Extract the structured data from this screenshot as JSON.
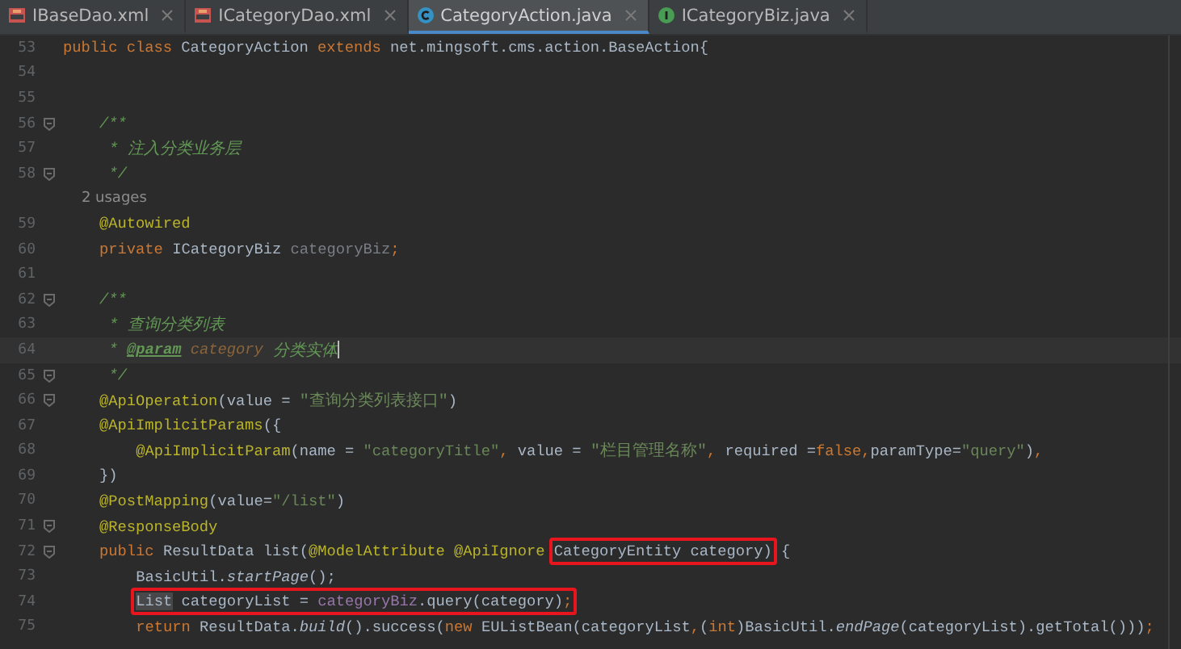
{
  "tabs": [
    {
      "label": "IBaseDao.xml",
      "kind": "xml",
      "selected": false
    },
    {
      "label": "ICategoryDao.xml",
      "kind": "xml",
      "selected": false
    },
    {
      "label": "CategoryAction.java",
      "kind": "class",
      "selected": true
    },
    {
      "label": "ICategoryBiz.java",
      "kind": "interface",
      "selected": false
    }
  ],
  "lines": [
    {
      "kind": "code",
      "number": "53",
      "fold": false,
      "current": false,
      "segments": [
        {
          "kind": "keyword",
          "text": "public class "
        },
        {
          "kind": "plain",
          "text": "CategoryAction "
        },
        {
          "kind": "keyword",
          "text": "extends "
        },
        {
          "kind": "plain",
          "text": "net.mingsoft.cms.action.BaseAction{"
        }
      ]
    },
    {
      "kind": "code",
      "number": "54",
      "fold": false,
      "current": false
    },
    {
      "kind": "code",
      "number": "55",
      "fold": false,
      "current": false
    },
    {
      "kind": "code",
      "number": "56",
      "fold": true,
      "current": false,
      "segments": [
        {
          "kind": "doc",
          "text": "    /**"
        }
      ]
    },
    {
      "kind": "code",
      "number": "57",
      "fold": false,
      "current": false,
      "segments": [
        {
          "kind": "doc",
          "text": "     * 注入分类业务层"
        }
      ]
    },
    {
      "kind": "code",
      "number": "58",
      "fold": true,
      "current": false,
      "segments": [
        {
          "kind": "doc",
          "text": "     */"
        }
      ]
    },
    {
      "kind": "hint",
      "text": "2 usages"
    },
    {
      "kind": "code",
      "number": "59",
      "fold": false,
      "current": false,
      "segments": [
        {
          "kind": "annotation",
          "text": "    @Autowired"
        }
      ]
    },
    {
      "kind": "code",
      "number": "60",
      "fold": false,
      "current": false,
      "segments": [
        {
          "kind": "keyword",
          "text": "    private "
        },
        {
          "kind": "plain",
          "text": "ICategoryBiz "
        },
        {
          "kind": "unused",
          "text": "categoryBiz"
        },
        {
          "kind": "keyword",
          "text": ";"
        }
      ]
    },
    {
      "kind": "code",
      "number": "61",
      "fold": false,
      "current": false
    },
    {
      "kind": "code",
      "number": "62",
      "fold": true,
      "current": false,
      "segments": [
        {
          "kind": "doc",
          "text": "    /**"
        }
      ]
    },
    {
      "kind": "code",
      "number": "63",
      "fold": false,
      "current": false,
      "segments": [
        {
          "kind": "doc",
          "text": "     * 查询分类列表"
        }
      ]
    },
    {
      "kind": "code",
      "number": "64",
      "fold": false,
      "current": true,
      "segments": [
        {
          "kind": "doc",
          "text": "     * "
        },
        {
          "kind": "doctag",
          "text": "@param"
        },
        {
          "kind": "docparam",
          "text": " category"
        },
        {
          "kind": "doc",
          "text": " 分类实体"
        }
      ]
    },
    {
      "kind": "code",
      "number": "65",
      "fold": true,
      "current": false,
      "segments": [
        {
          "kind": "doc",
          "text": "     */"
        }
      ]
    },
    {
      "kind": "code",
      "number": "66",
      "fold": true,
      "current": false,
      "segments": [
        {
          "kind": "annotation",
          "text": "    @ApiOperation"
        },
        {
          "kind": "plain",
          "text": "(value = "
        },
        {
          "kind": "string",
          "text": "\"查询分类列表接口\""
        },
        {
          "kind": "plain",
          "text": ")"
        }
      ]
    },
    {
      "kind": "code",
      "number": "67",
      "fold": false,
      "current": false,
      "segments": [
        {
          "kind": "annotation",
          "text": "    @ApiImplicitParams"
        },
        {
          "kind": "plain",
          "text": "({"
        }
      ]
    },
    {
      "kind": "code",
      "number": "68",
      "fold": false,
      "current": false,
      "segments": [
        {
          "kind": "annotation",
          "text": "        @ApiImplicitParam"
        },
        {
          "kind": "plain",
          "text": "(name = "
        },
        {
          "kind": "string",
          "text": "\"categoryTitle\""
        },
        {
          "kind": "keyword",
          "text": ", "
        },
        {
          "kind": "plain",
          "text": "value = "
        },
        {
          "kind": "string",
          "text": "\"栏目管理名称\""
        },
        {
          "kind": "keyword",
          "text": ", "
        },
        {
          "kind": "plain",
          "text": "required ="
        },
        {
          "kind": "keyword",
          "text": "false,"
        },
        {
          "kind": "plain",
          "text": "paramType="
        },
        {
          "kind": "string",
          "text": "\"query\""
        },
        {
          "kind": "plain",
          "text": ")"
        },
        {
          "kind": "keyword",
          "text": ","
        }
      ]
    },
    {
      "kind": "code",
      "number": "69",
      "fold": false,
      "current": false,
      "segments": [
        {
          "kind": "plain",
          "text": "    })"
        }
      ]
    },
    {
      "kind": "code",
      "number": "70",
      "fold": false,
      "current": false,
      "segments": [
        {
          "kind": "annotation",
          "text": "    @PostMapping"
        },
        {
          "kind": "plain",
          "text": "(value="
        },
        {
          "kind": "string",
          "text": "\"/list\""
        },
        {
          "kind": "plain",
          "text": ")"
        }
      ]
    },
    {
      "kind": "code",
      "number": "71",
      "fold": true,
      "current": false,
      "segments": [
        {
          "kind": "annotation",
          "text": "    @ResponseBody"
        }
      ]
    },
    {
      "kind": "code",
      "number": "72",
      "fold": true,
      "current": false,
      "segments": [
        {
          "kind": "keyword",
          "text": "    public "
        },
        {
          "kind": "plain",
          "text": "ResultData list("
        },
        {
          "kind": "annotation",
          "text": "@ModelAttribute @ApiIgnore "
        },
        {
          "kind": "box",
          "segments": [
            {
              "kind": "plain",
              "text": "CategoryEntity category)"
            }
          ]
        },
        {
          "kind": "plain",
          "text": " {"
        }
      ]
    },
    {
      "kind": "code",
      "number": "73",
      "fold": false,
      "current": false,
      "segments": [
        {
          "kind": "plain",
          "text": "        BasicUtil."
        },
        {
          "kind": "static",
          "text": "startPage"
        },
        {
          "kind": "plain",
          "text": "();"
        }
      ]
    },
    {
      "kind": "code",
      "number": "74",
      "fold": false,
      "current": false,
      "segments": [
        {
          "kind": "box",
          "segments": [
            {
              "kind": "highlight",
              "text": "        List"
            },
            {
              "kind": "plain",
              "text": " categoryList = "
            },
            {
              "kind": "field",
              "text": "categoryBiz"
            },
            {
              "kind": "plain",
              "text": ".query(category)"
            },
            {
              "kind": "keyword",
              "text": ";"
            }
          ]
        }
      ]
    },
    {
      "kind": "code",
      "number": "75",
      "fold": false,
      "current": false,
      "segments": [
        {
          "kind": "keyword",
          "text": "        return "
        },
        {
          "kind": "plain",
          "text": "ResultData."
        },
        {
          "kind": "static",
          "text": "build"
        },
        {
          "kind": "plain",
          "text": "().success("
        },
        {
          "kind": "keyword",
          "text": "new "
        },
        {
          "kind": "plain",
          "text": "EUListBean(categoryList"
        },
        {
          "kind": "keyword",
          "text": ","
        },
        {
          "kind": "plain",
          "text": "("
        },
        {
          "kind": "keyword",
          "text": "int"
        },
        {
          "kind": "plain",
          "text": ")BasicUtil."
        },
        {
          "kind": "static",
          "text": "endPage"
        },
        {
          "kind": "plain",
          "text": "(categoryList).getTotal()))"
        },
        {
          "kind": "keyword",
          "text": ";"
        }
      ]
    }
  ]
}
